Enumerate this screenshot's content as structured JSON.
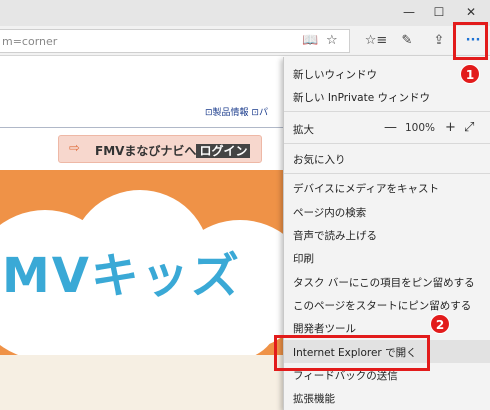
{
  "browser": {
    "url_fragment": "m=corner",
    "min_icon": "—",
    "max_icon": "☐",
    "close_icon": "✕",
    "reading_icon": "📖",
    "favorite_icon": "☆",
    "hub_icon": "☆≡",
    "notes_icon": "✎",
    "share_icon": "⇪",
    "more_icon": "···"
  },
  "page": {
    "nav_links": "⊡製品情報  ⊡パ",
    "login_arrow": "⇨",
    "login_text": "FMVまなびナビへ",
    "login_strong": "ログイン",
    "logo_text": "MVキッズ"
  },
  "menu": {
    "new_window": "新しいウィンドウ",
    "new_inprivate": "新しい InPrivate ウィンドウ",
    "zoom_label": "拡大",
    "zoom_minus": "—",
    "zoom_value": "100%",
    "zoom_plus": "+",
    "fullscreen_icon": "⤢",
    "favorites": "お気に入り",
    "cast": "デバイスにメディアをキャスト",
    "find": "ページ内の検索",
    "read_aloud": "音声で読み上げる",
    "print": "印刷",
    "pin_taskbar": "タスク バーにこの項目をピン留めする",
    "pin_start": "このページをスタートにピン留めする",
    "dev_tools": "開発者ツール",
    "open_ie": "Internet Explorer で開く",
    "feedback": "フィードバックの送信",
    "extensions": "拡張機能"
  },
  "annotations": {
    "badge1": "1",
    "badge2": "2"
  },
  "colors": {
    "banner": "#ef9247",
    "accent_red": "#e21b1b",
    "edge_blue": "#1e73d4"
  }
}
